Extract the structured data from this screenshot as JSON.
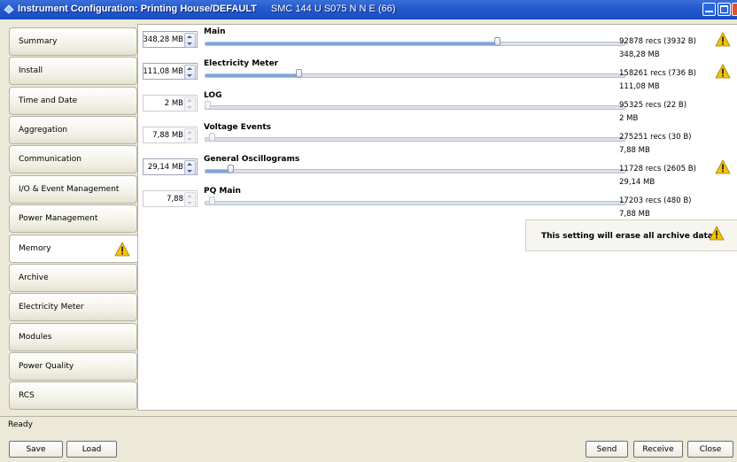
{
  "window": {
    "title": "Instrument Configuration: Printing House/DEFAULT",
    "device": "SMC 144 U S075 N N E (66)"
  },
  "sidebar": {
    "items": [
      {
        "label": "Summary",
        "active": false,
        "warning": false
      },
      {
        "label": "Install",
        "active": false,
        "warning": false
      },
      {
        "label": "Time and Date",
        "active": false,
        "warning": false
      },
      {
        "label": "Aggregation",
        "active": false,
        "warning": false
      },
      {
        "label": "Communication",
        "active": false,
        "warning": false
      },
      {
        "label": "I/O & Event Management",
        "active": false,
        "warning": false
      },
      {
        "label": "Power Management",
        "active": false,
        "warning": false
      },
      {
        "label": "Memory",
        "active": true,
        "warning": true
      },
      {
        "label": "Archive",
        "active": false,
        "warning": false
      },
      {
        "label": "Electricity Meter",
        "active": false,
        "warning": false
      },
      {
        "label": "Modules",
        "active": false,
        "warning": false
      },
      {
        "label": "Power Quality",
        "active": false,
        "warning": false
      },
      {
        "label": "RCS",
        "active": false,
        "warning": false
      }
    ]
  },
  "memory": {
    "slider_max_mb": 500,
    "rows": [
      {
        "name": "Main",
        "value": "348,28 MB",
        "value_mb": 348.28,
        "recs": "92878 recs (3932 B)",
        "size": "348,28 MB",
        "enabled": true,
        "warning": true
      },
      {
        "name": "Electricity Meter",
        "value": "111,08 MB",
        "value_mb": 111.08,
        "recs": "158261 recs (736 B)",
        "size": "111,08 MB",
        "enabled": true,
        "warning": true
      },
      {
        "name": "LOG",
        "value": "2 MB",
        "value_mb": 2,
        "recs": "95325 recs (22 B)",
        "size": "2 MB",
        "enabled": false,
        "warning": false
      },
      {
        "name": "Voltage Events",
        "value": "7,88 MB",
        "value_mb": 7.88,
        "recs": "275251 recs (30 B)",
        "size": "7,88 MB",
        "enabled": false,
        "warning": false
      },
      {
        "name": "General Oscillograms",
        "value": "29,14 MB",
        "value_mb": 29.14,
        "recs": "11728 recs (2605 B)",
        "size": "29,14 MB",
        "enabled": true,
        "warning": true
      },
      {
        "name": "PQ Main",
        "value": "7,88",
        "value_mb": 7.88,
        "recs": "17203 recs (480 B)",
        "size": "7,88 MB",
        "enabled": false,
        "warning": false
      }
    ],
    "erase_note": "This setting will erase all archive data."
  },
  "status": {
    "text": "Ready"
  },
  "footer": {
    "save_label": "Save",
    "load_label": "Load",
    "send_label": "Send",
    "receive_label": "Receive",
    "close_label": "Close"
  }
}
